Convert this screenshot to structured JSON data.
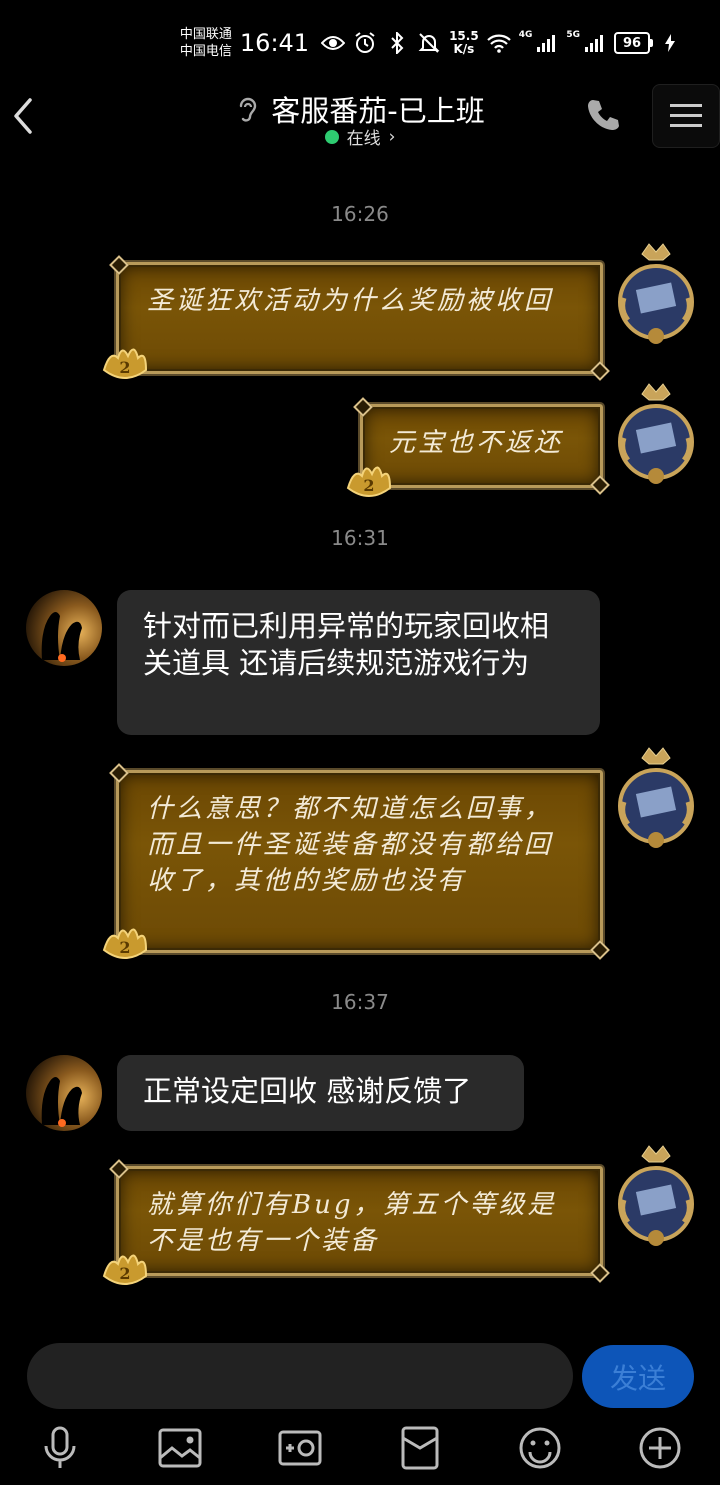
{
  "status_bar": {
    "carrier1": "中国联通",
    "carrier2": "中国电信",
    "time": "16:41",
    "speed_value": "15.5",
    "speed_unit": "K/s",
    "net1": "4G",
    "net2": "5G",
    "battery": "96"
  },
  "header": {
    "title": "客服番茄-已上班",
    "status": "在线",
    "status_arrow": "›",
    "online_color": "#2ecc71"
  },
  "messages": {
    "time1": "16:26",
    "msg1": "圣诞狂欢活动为什么奖励被收回",
    "msg2": "元宝也不返还",
    "time2": "16:31",
    "reply1": "针对而已利用异常的玩家回收相关道具  还请后续规范游戏行为",
    "msg3": "什么意思？都不知道怎么回事，而且一件圣诞装备都没有都给回收了，其他的奖励也没有",
    "time3": "16:37",
    "reply2": "正常设定回收 感谢反馈了",
    "msg4": "就算你们有Bug，第五个等级是不是也有一个装备"
  },
  "composer": {
    "send_label": "发送",
    "send_color": "#0d55b8"
  },
  "toolbar_icons": [
    "mic-icon",
    "image-icon",
    "camera-icon",
    "red-packet-icon",
    "emoji-icon",
    "plus-icon"
  ]
}
